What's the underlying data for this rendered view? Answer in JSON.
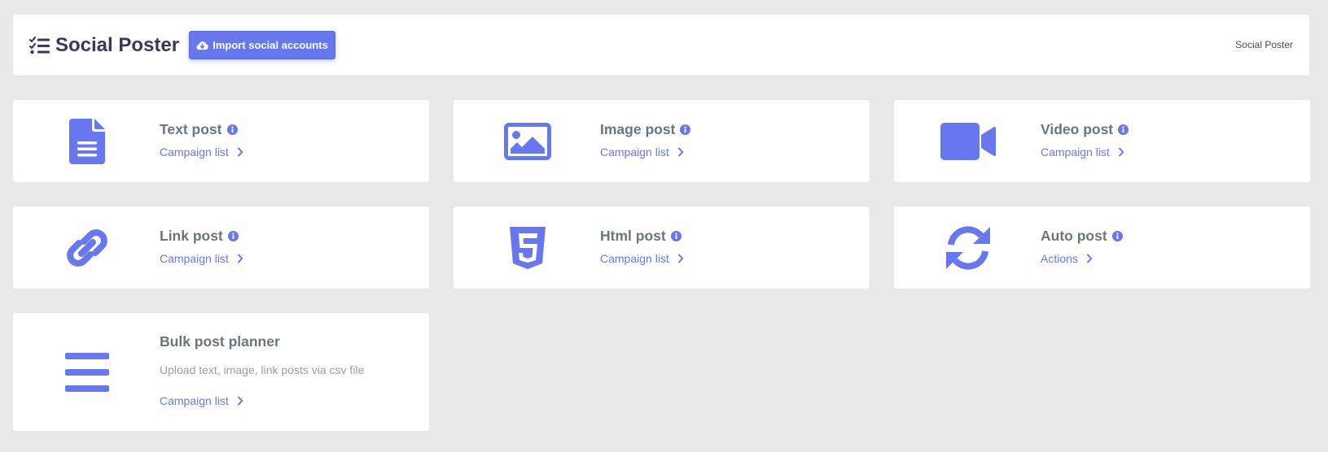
{
  "header": {
    "title": "Social Poster",
    "import_button_label": "Import social accounts",
    "breadcrumb": "Social Poster"
  },
  "colors": {
    "accent": "#6777ef",
    "background": "#e8e8e8",
    "title": "#34395e",
    "card_title": "#6c757d",
    "muted_text": "#9a9ea4"
  },
  "cards": [
    {
      "name": "Text post",
      "icon": "file-text-icon",
      "link": "Campaign list",
      "has_info": true
    },
    {
      "name": "Image post",
      "icon": "image-icon",
      "link": "Campaign list",
      "has_info": true
    },
    {
      "name": "Video post",
      "icon": "video-camera-icon",
      "link": "Campaign list",
      "has_info": true
    },
    {
      "name": "Link post",
      "icon": "link-icon",
      "link": "Campaign list",
      "has_info": true
    },
    {
      "name": "Html post",
      "icon": "html5-icon",
      "link": "Campaign list",
      "has_info": true
    },
    {
      "name": "Auto post",
      "icon": "sync-icon",
      "link": "Actions",
      "has_info": true
    },
    {
      "name": "Bulk post planner",
      "icon": "bars-icon",
      "description": "Upload text, image, link posts via csv file",
      "link": "Campaign list",
      "has_info": false
    }
  ]
}
